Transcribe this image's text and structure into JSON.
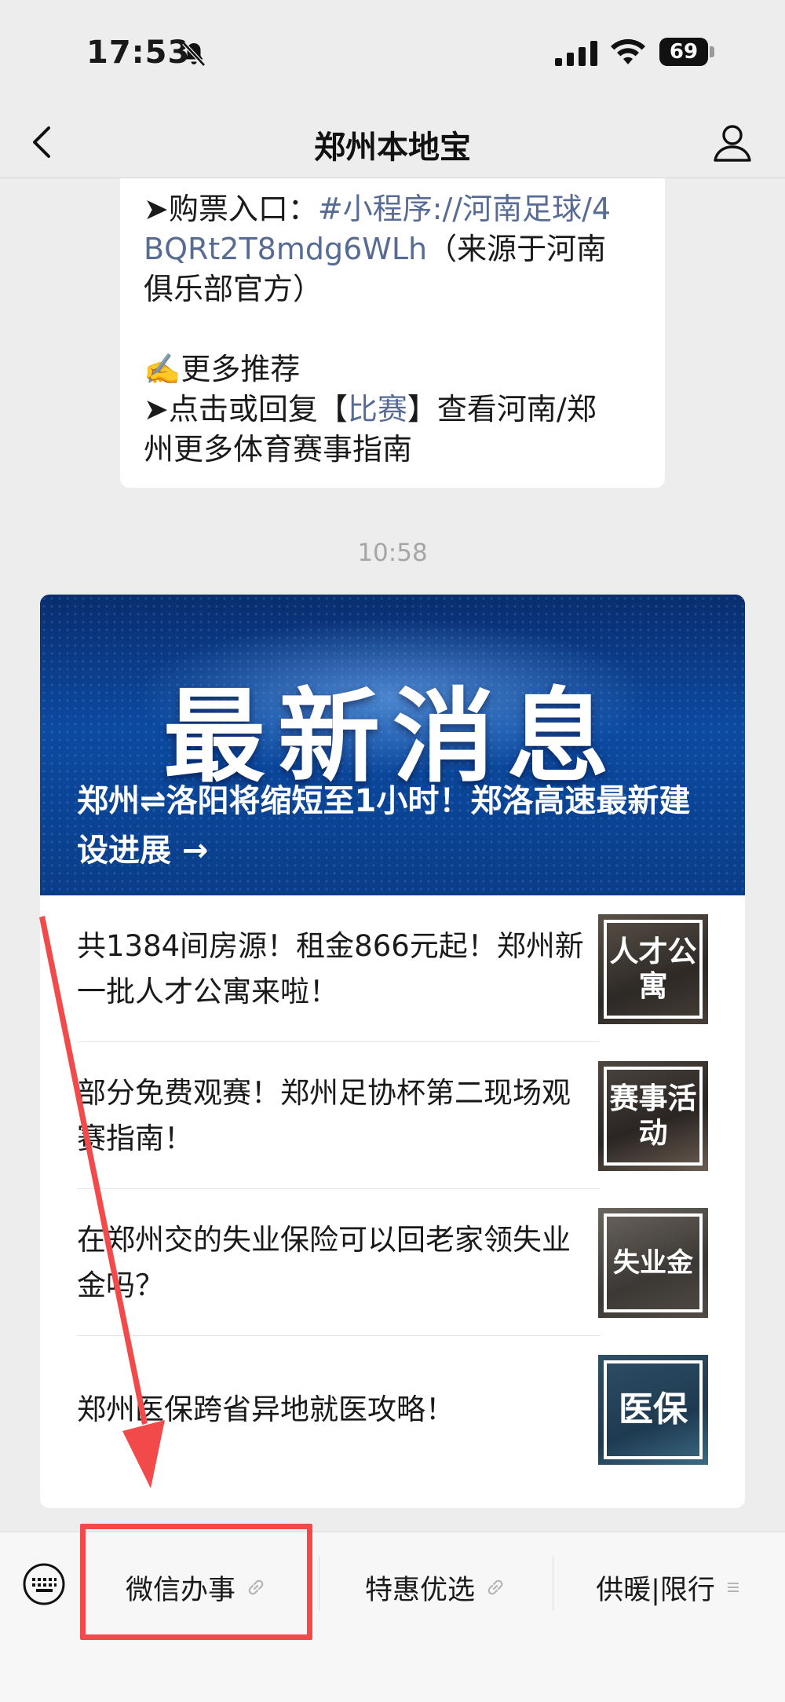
{
  "status_bar": {
    "time": "17:53",
    "battery": "69",
    "icons": [
      "bell-off-icon",
      "signal-icon",
      "wifi-icon",
      "battery-icon"
    ]
  },
  "nav": {
    "title": "郑州本地宝",
    "back_icon": "chevron-left-icon",
    "profile_icon": "person-icon"
  },
  "text_message": {
    "line1_prefix": "➤购票入口：",
    "line1_link": "#小程序://河南足球/4",
    "line2_link": "BQRt2T8mdg6WLh",
    "line2_rest": "（来源于河南",
    "line3": "俱乐部官方）",
    "line5": "✍️更多推荐",
    "line6_prefix": "➤点击或回复【",
    "line6_link": "比赛",
    "line6_suffix": "】查看河南/郑",
    "line7": "州更多体育赛事指南"
  },
  "timestamp": "10:58",
  "article": {
    "banner_heading": "最新消息",
    "banner_title": "郑州⇌洛阳将缩短至1小时！郑洛高速最新建设进展 →",
    "items": [
      {
        "title": "共1384间房源！租金866元起！郑州新一批人才公寓来啦！",
        "thumb": "人才公寓"
      },
      {
        "title": "部分免费观赛！郑州足协杯第二现场观赛指南！",
        "thumb": "赛事活动"
      },
      {
        "title": "在郑州交的失业保险可以回老家领失业金吗？",
        "thumb": "失业金"
      },
      {
        "title": "郑州医保跨省异地就医攻略！",
        "thumb": "医保"
      }
    ]
  },
  "menu": {
    "keyboard_icon": "keyboard-icon",
    "items": [
      {
        "label": "微信办事",
        "icon": "link-icon"
      },
      {
        "label": "特惠优选",
        "icon": "link-icon"
      },
      {
        "label": "供暖|限行",
        "icon": "menu-lines-icon"
      }
    ]
  },
  "annotation": {
    "color": "#f24a4a"
  }
}
